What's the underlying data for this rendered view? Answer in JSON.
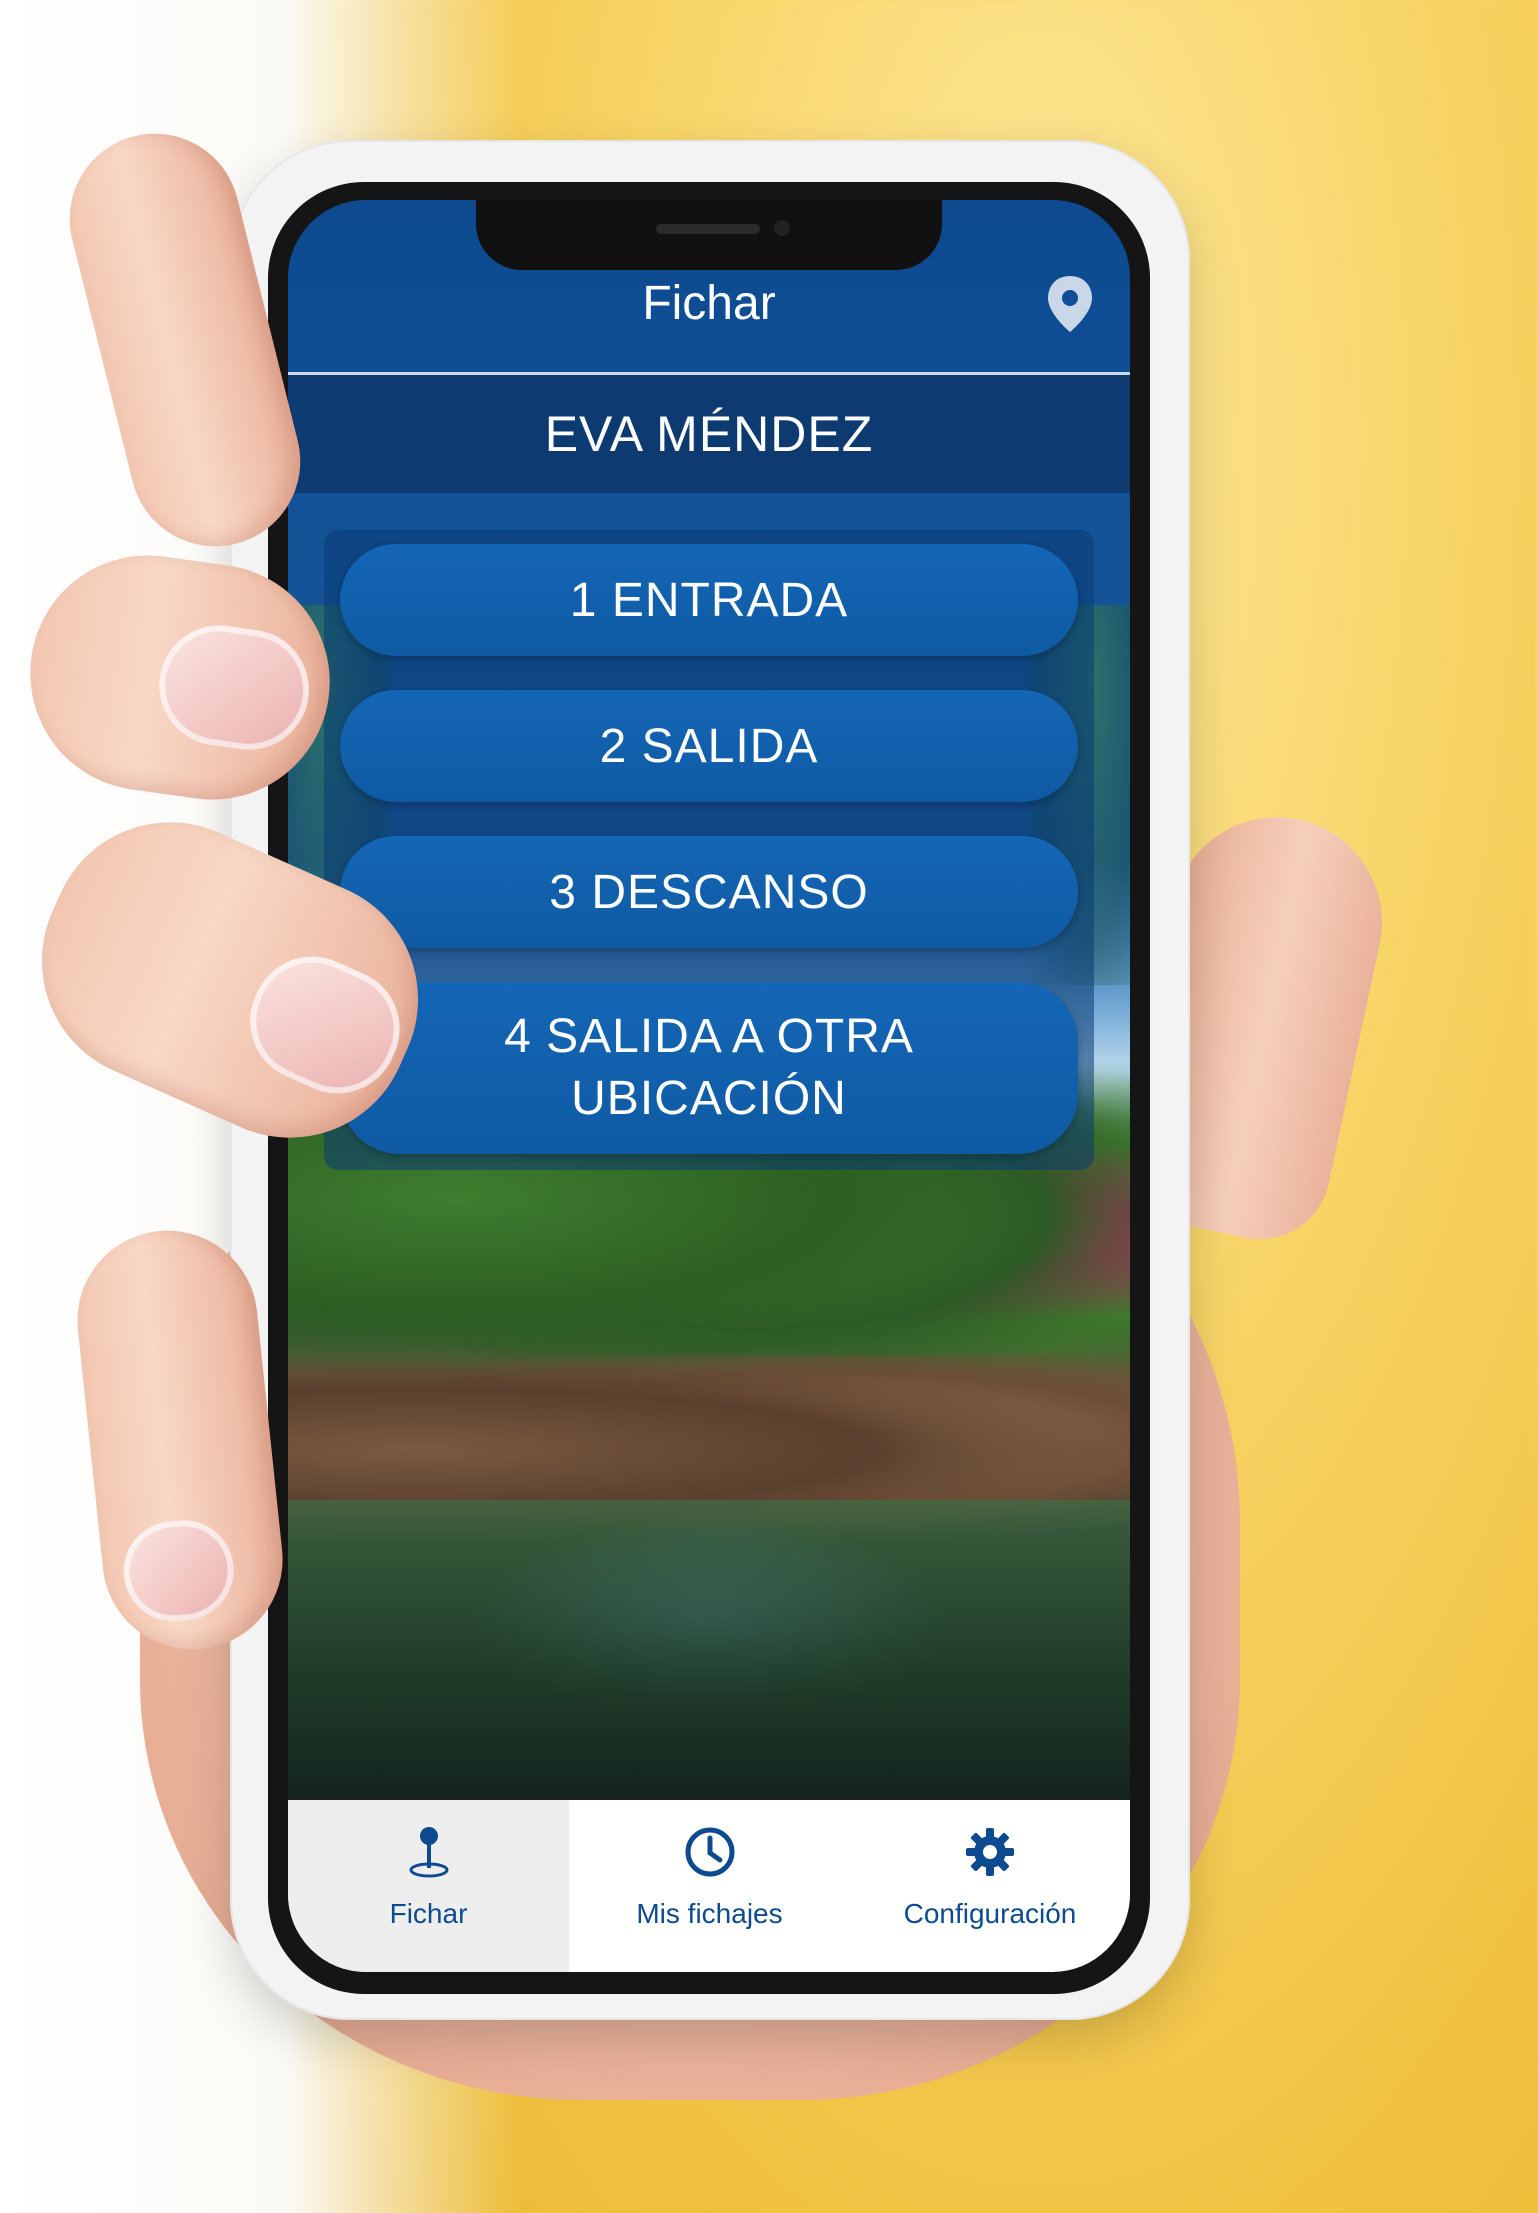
{
  "header": {
    "title": "Fichar",
    "location_icon": "location-pin-icon"
  },
  "user": {
    "name": "EVA MÉNDEZ"
  },
  "actions": [
    {
      "label": "1  ENTRADA"
    },
    {
      "label": "2  SALIDA"
    },
    {
      "label": "3  DESCANSO"
    },
    {
      "label": "4  SALIDA A OTRA UBICACIÓN"
    }
  ],
  "tabs": [
    {
      "label": "Fichar",
      "icon": "map-pin-icon",
      "active": true
    },
    {
      "label": "Mis fichajes",
      "icon": "clock-icon",
      "active": false
    },
    {
      "label": "Configuración",
      "icon": "gear-icon",
      "active": false
    }
  ],
  "colors": {
    "primary": "#0d4a8f",
    "button": "#1466b6",
    "tab_active_bg": "#eeeeef",
    "background_yellow": "#f6cf55"
  }
}
